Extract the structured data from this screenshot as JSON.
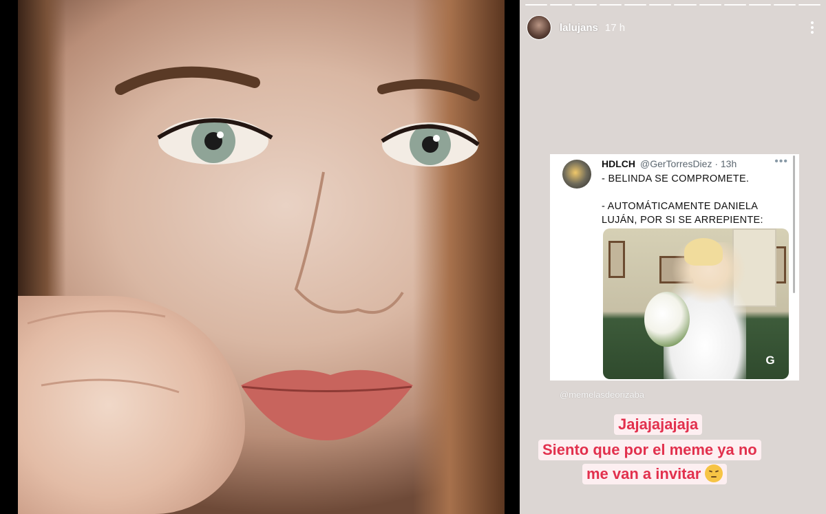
{
  "story": {
    "username": "lalujans",
    "time": "17 h",
    "progress_segments_total": 12,
    "progress_segments_done": 12,
    "tweet": {
      "name": "HDLCH",
      "handle": "@GerTorresDiez · 13h",
      "line1": "- BELINDA SE COMPROMETE.",
      "line2": "- AUTOMÁTICAMENTE DANIELA",
      "line3": "LUJÁN, POR SI SE ARREPIENTE:",
      "gif_icon": "G"
    },
    "mention": "@memelasdeorizaba",
    "caption": {
      "line1": "Jajajajajaja",
      "line2": "Siento que por el meme ya no",
      "line3": "me van a invitar",
      "emoji": "pensive-face-emoji"
    }
  },
  "colors": {
    "caption_text": "#e2304d",
    "caption_bg": "#fdeff1",
    "story_bg": "#dcd6d3"
  },
  "icons": {
    "more": "more-vertical-icon",
    "tweet_more": "more-horizontal-icon",
    "gif": "gif-loop-icon"
  }
}
